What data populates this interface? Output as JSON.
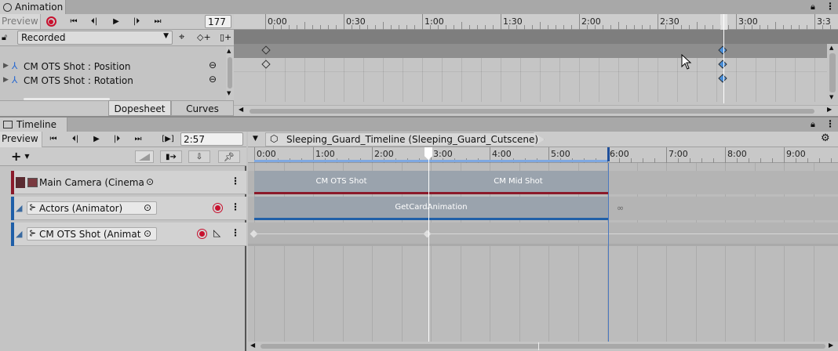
{
  "animation_window": {
    "tab_label": "Animation",
    "preview_label": "Preview",
    "frame_value": "177",
    "clip_dropdown": "Recorded",
    "properties": [
      {
        "label": "CM OTS Shot : Position"
      },
      {
        "label": "CM OTS Shot : Rotation"
      }
    ],
    "ruler_labels": [
      "0:00",
      "0:30",
      "1:00",
      "1:30",
      "2:00",
      "2:30",
      "3:00",
      "3:3"
    ],
    "view_tabs": {
      "dopesheet": "Dopesheet",
      "curves": "Curves"
    }
  },
  "timeline_window": {
    "tab_label": "Timeline",
    "preview_label": "Preview",
    "time_value": "2:57",
    "breadcrumb": "Sleeping_Guard_Timeline (Sleeping_Guard_Cutscene)",
    "ruler_labels": [
      "0:00",
      "1:00",
      "2:00",
      "3:00",
      "4:00",
      "5:00",
      "6:00",
      "7:00",
      "8:00",
      "9:00"
    ],
    "tracks": [
      {
        "name": "Main Camera (Cinemac",
        "accent": "#8b1a2a"
      },
      {
        "name": "Actors (Animator)",
        "accent": "#1f5fa8"
      },
      {
        "name": "CM OTS Shot (Animator",
        "accent": "#1f5fa8"
      }
    ],
    "clips": {
      "cm_ots_shot": "CM OTS Shot",
      "cm_mid_shot": "CM Mid Shot",
      "get_card_animation": "GetCardAnimation"
    }
  },
  "colors": {
    "playhead": "#ffffff",
    "record": "#c8102e",
    "key_selected": "#4a8fd9",
    "camera_track": "#8b1a2a",
    "animation_track": "#1f5fa8"
  }
}
